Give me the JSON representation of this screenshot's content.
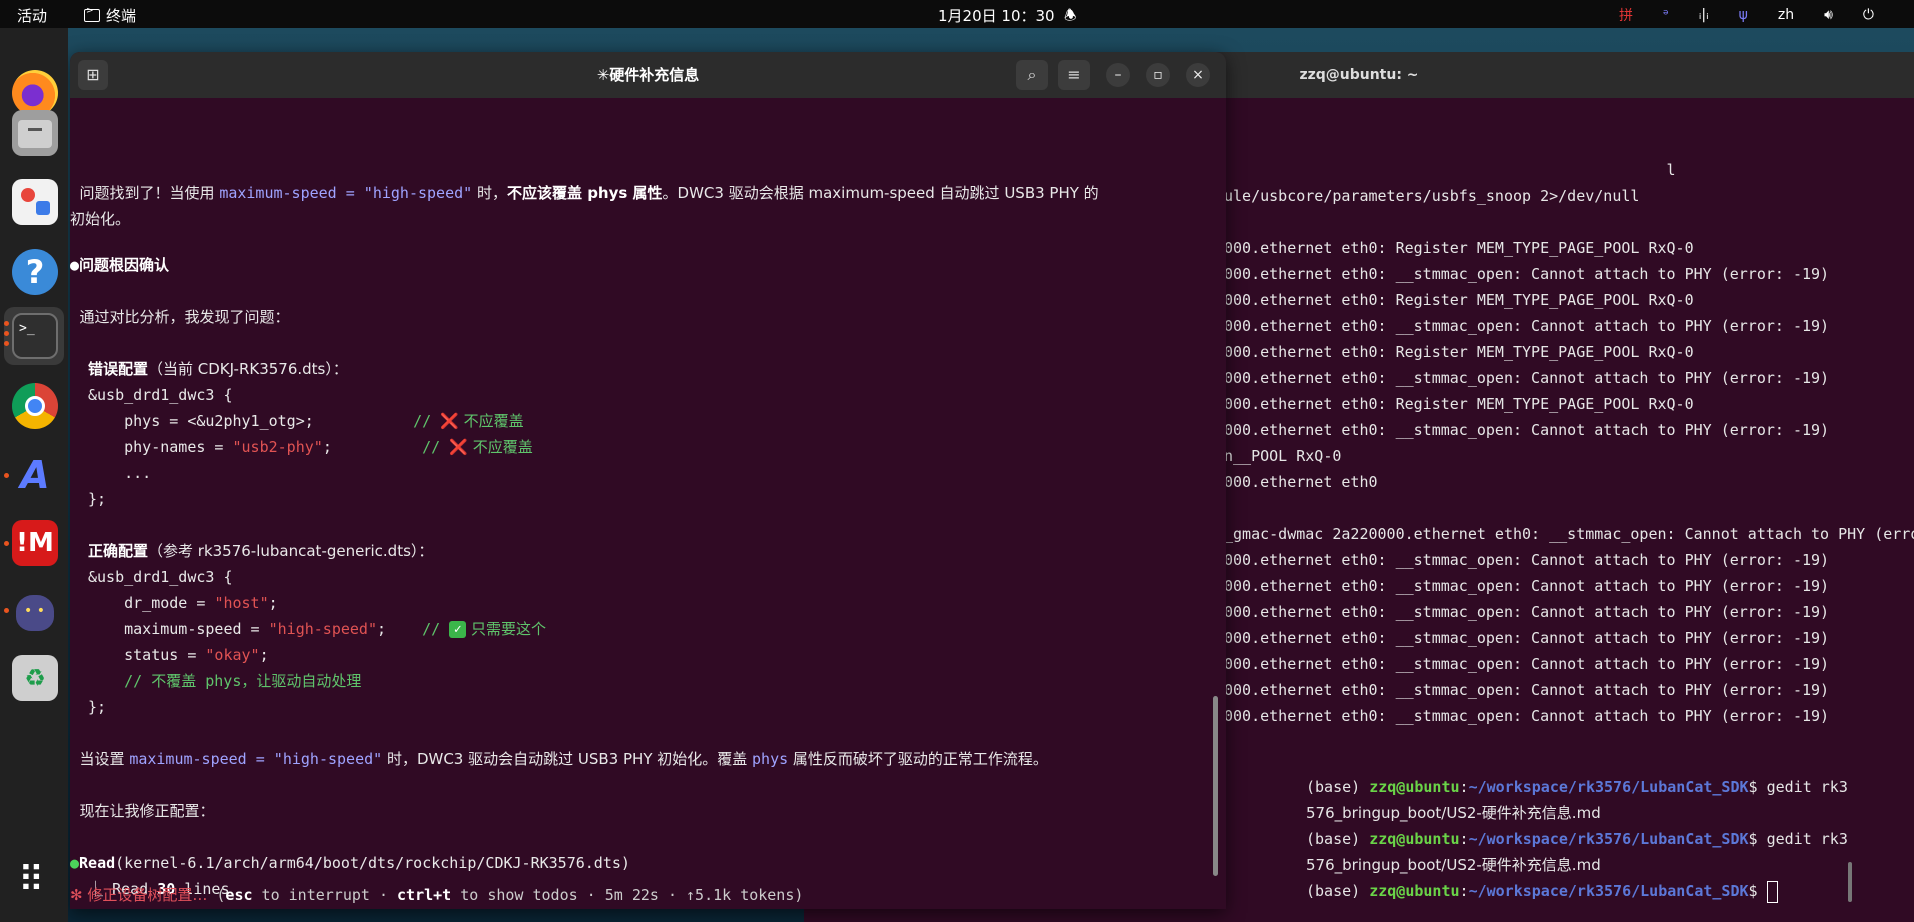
{
  "topbar": {
    "activities": "活动",
    "app": "终端",
    "clock": "1月20日  10：30",
    "bell": "🕭",
    "tray": {
      "ime_red": "拼",
      "ime_blue": "ᵊ",
      "net": "ᵢ|ᵢ",
      "app2": "ψ",
      "lang": "zh",
      "sound": "🔊︎",
      "power": "⏻"
    }
  },
  "dock": {
    "help": "?",
    "term": ">_",
    "ai": "A",
    "mem": "!M",
    "trash": "♻"
  },
  "bg_terminal": {
    "title": "zzq@ubuntu: ~",
    "lines": [
      "                                                 l",
      "ule/usbcore/parameters/usbfs_snoop 2>/dev/null",
      "",
      "000.ethernet eth0: Register MEM_TYPE_PAGE_POOL RxQ-0",
      "000.ethernet eth0: __stmmac_open: Cannot attach to PHY (error: -19)",
      "000.ethernet eth0: Register MEM_TYPE_PAGE_POOL RxQ-0",
      "000.ethernet eth0: __stmmac_open: Cannot attach to PHY (error: -19)",
      "000.ethernet eth0: Register MEM_TYPE_PAGE_POOL RxQ-0",
      "000.ethernet eth0: __stmmac_open: Cannot attach to PHY (error: -19)",
      "000.ethernet eth0: Register MEM_TYPE_PAGE_POOL RxQ-0",
      "000.ethernet eth0: __stmmac_open: Cannot attach to PHY (error: -19)",
      "n__POOL RxQ-0",
      "000.ethernet eth0",
      "",
      "_gmac-dwmac 2a220000.ethernet eth0: __stmmac_open: Cannot attach to PHY (erro",
      "000.ethernet eth0: __stmmac_open: Cannot attach to PHY (error: -19)",
      "000.ethernet eth0: __stmmac_open: Cannot attach to PHY (error: -19)",
      "000.ethernet eth0: __stmmac_open: Cannot attach to PHY (error: -19)",
      "000.ethernet eth0: __stmmac_open: Cannot attach to PHY (error: -19)",
      "000.ethernet eth0: __stmmac_open: Cannot attach to PHY (error: -19)",
      "000.ethernet eth0: __stmmac_open: Cannot attach to PHY (error: -19)",
      "000.ethernet eth0: __stmmac_open: Cannot attach to PHY (error: -19)"
    ]
  },
  "small_terminal": {
    "prefix": "(base) ",
    "user": "zzq@ubuntu",
    "colon": ":",
    "path": "~/workspace/rk3576/LubanCat_SDK",
    "dollar": "$ ",
    "cmd": "gedit rk3",
    "cont": "576_bringup_boot/US2-硬件补充信息.md"
  },
  "main": {
    "title": "✳硬件补充信息",
    "newtab": "⊞",
    "search": "⌕",
    "menu": "≡",
    "minimize": "–",
    "maximize": "▫",
    "close": "×",
    "line1_a": "  问题找到了！当使用 ",
    "line1_code": "maximum-speed = \"high-speed\"",
    "line1_b": " 时，",
    "line1_bold": "不应该覆盖 phys 属性",
    "line1_c": "。DWC3 驱动会根据 maximum-speed 自动跳过 USB3 PHY 的",
    "line2": "初始化。",
    "bullet": "●",
    "heading": "问题根因确认",
    "analysis": "  通过对比分析，我发现了问题：",
    "wrong_bold": "错误配置",
    "wrong_rest": "（当前 CDKJ-RK3576.dts）：",
    "code_open": "&usb_drd1_dwc3 {",
    "phys_a": "    phys = <&u2phy1_otg>;           ",
    "cmt_pre": "// ",
    "xmark": "❌",
    "no_override": " 不应覆盖",
    "phynames_a": "    phy-names = ",
    "phynames_str": "\"usb2-phy\"",
    "phynames_b": ";          ",
    "dots": "    ...",
    "code_close": "};",
    "right_bold": "正确配置",
    "right_rest": "（参考 rk3576-lubancat-generic.dts）：",
    "dr_mode_a": "    dr_mode = ",
    "dr_mode_str": "\"host\"",
    "semi": ";",
    "maxspeed_a": "    maximum-speed = ",
    "maxspeed_str": "\"high-speed\"",
    "maxspeed_b": ";    ",
    "check": "✓",
    "only_need": " 只需要这个",
    "status_a": "    status = ",
    "status_str": "\"okay\"",
    "comment_phys": "    // 不覆盖 phys，让驱动自动处理",
    "explain_a": "  当设置 ",
    "explain_code": "maximum-speed = \"high-speed\"",
    "explain_b": " 时，DWC3 驱动会自动跳过 USB3 PHY 初始化。覆盖 ",
    "explain_phys": "phys",
    "explain_c": " 属性反而破坏了驱动的正常工作流程。",
    "fix_now": "  现在让我修正配置：",
    "read_label": "Read",
    "read_path": "(kernel-6.1/arch/arm64/boot/dts/rockchip/CDKJ-RK3576.dts)",
    "read_sub_a": "  ⎿ Read ",
    "read_sub_n": "30",
    "read_sub_b": " lines",
    "status_star": "✻",
    "status_task": " 修正设备树配置…",
    "status_p1": " (",
    "status_esc": "esc",
    "status_p2": " to interrupt · ",
    "status_ctrl": "ctrl+t",
    "status_p3": " to show todos · 5m 22s · ↑5.1k tokens)"
  }
}
